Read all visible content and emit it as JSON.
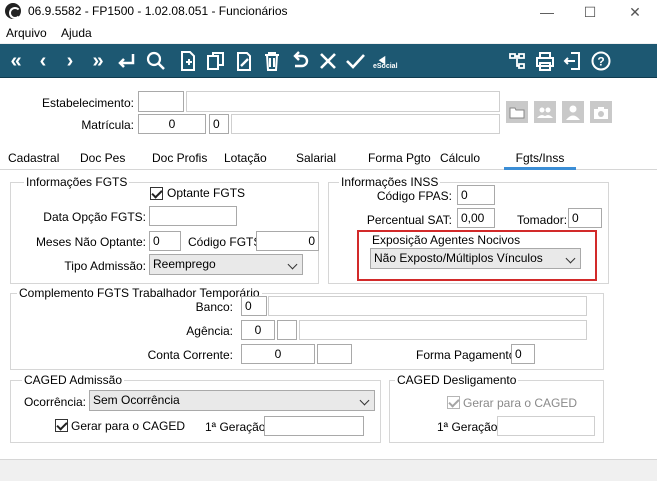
{
  "window": {
    "title": "06.9.5582 - FP1500 - 1.02.08.051 - Funcionários",
    "minimize": "—",
    "maximize": "☐",
    "close": "✕"
  },
  "menu": {
    "items": [
      "Arquivo",
      "Ajuda"
    ]
  },
  "toolbar": {
    "esocial_label": "eSocial"
  },
  "header": {
    "estabelecimento_label": "Estabelecimento:",
    "estabelecimento_code": "",
    "estabelecimento_name": "",
    "matricula_label": "Matrícula:",
    "matricula_value": "0",
    "matricula_digit": "0",
    "matricula_name": ""
  },
  "tabs": [
    "Cadastral",
    "Doc Pes",
    "Doc Profis",
    "Lotação",
    "Salarial",
    "Forma Pgto",
    "Cálculo",
    "Fgts/Inss"
  ],
  "fgts": {
    "group_title": "Informações FGTS",
    "optante_label": "Optante FGTS",
    "data_opcao_label": "Data Opção FGTS:",
    "data_opcao_value": "",
    "meses_label": "Meses Não Optante:",
    "meses_value": "0",
    "codigo_label": "Código FGTS:",
    "codigo_value": "0",
    "tipo_label": "Tipo Admissão:",
    "tipo_value": "Reemprego"
  },
  "inss": {
    "group_title": "Informações INSS",
    "codigo_fpas_label": "Código FPAS:",
    "codigo_fpas_value": "0",
    "percentual_label": "Percentual SAT:",
    "percentual_value": "0,00",
    "tomador_label": "Tomador:",
    "tomador_value": "0",
    "exposicao_title": "Exposição Agentes Nocivos",
    "exposicao_value": "Não Exposto/Múltiplos Vínculos"
  },
  "complemento": {
    "group_title": "Complemento FGTS Trabalhador Temporário",
    "banco_label": "Banco:",
    "banco_value": "0",
    "agencia_label": "Agência:",
    "agencia_value": "0",
    "conta_label": "Conta Corrente:",
    "conta_value": "0",
    "forma_label": "Forma Pagamento:",
    "forma_value": "0"
  },
  "caged_admissao": {
    "group_title": "CAGED Admissão",
    "ocorrencia_label": "Ocorrência:",
    "ocorrencia_value": "Sem Ocorrência",
    "gerar_label": "Gerar para o CAGED",
    "geracao_label": "1ª Geração:",
    "geracao_value": ""
  },
  "caged_desligamento": {
    "group_title": "CAGED Desligamento",
    "gerar_label": "Gerar para o CAGED",
    "geracao_label": "1ª Geração:",
    "geracao_value": ""
  },
  "colors": {
    "toolbar": "#1d5872",
    "active_tab": "#3b8ed6",
    "highlight": "#d22a2a"
  }
}
